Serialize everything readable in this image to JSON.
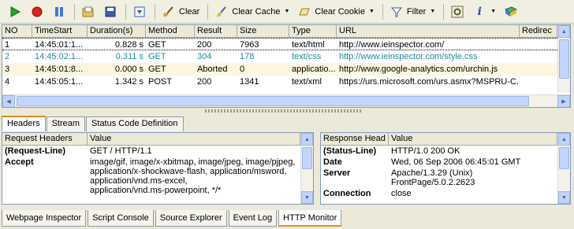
{
  "toolbar": {
    "clear_label": "Clear",
    "clear_cache_label": "Clear Cache",
    "clear_cookie_label": "Clear Cookie",
    "filter_label": "Filter"
  },
  "grid": {
    "columns": [
      "NO",
      "TimeStart",
      "Duration(s)",
      "Method",
      "Result",
      "Size",
      "Type",
      "URL",
      "Redirec"
    ],
    "rows": [
      {
        "no": "1",
        "time": "14:45:01:1...",
        "dur": "0.828 s",
        "method": "GET",
        "result": "200",
        "size": "7963",
        "type": "text/html",
        "url": "http://www.ieinspector.com/",
        "redirect": ""
      },
      {
        "no": "2",
        "time": "14:45:02:1...",
        "dur": "0.311 s",
        "method": "GET",
        "result": "304",
        "size": "178",
        "type": "text/css",
        "url": "http://www.ieinspector.com/style.css",
        "redirect": ""
      },
      {
        "no": "3",
        "time": "14:45:01:8...",
        "dur": "0.000 s",
        "method": "GET",
        "result": "Aborted",
        "size": "0",
        "type": "applicatio...",
        "url": "http://www.google-analytics.com/urchin.js",
        "redirect": ""
      },
      {
        "no": "4",
        "time": "14:45:05:1...",
        "dur": "1.342 s",
        "method": "POST",
        "result": "200",
        "size": "1341",
        "type": "text/xml",
        "url": "https://urs.microsoft.com/urs.asmx?MSPRU-C...",
        "redirect": ""
      }
    ]
  },
  "tabs": [
    "Headers",
    "Stream",
    "Status Code Definition"
  ],
  "request_panel": {
    "col_key": "Request Headers",
    "col_value": "Value",
    "rows": [
      {
        "key": "(Request-Line)",
        "value": "GET / HTTP/1.1"
      },
      {
        "key": "Accept",
        "value": "image/gif, image/x-xbitmap, image/jpeg, image/pjpeg,\napplication/x-shockwave-flash, application/msword,\napplication/vnd.ms-excel,\napplication/vnd.ms-powerpoint, */*"
      }
    ]
  },
  "response_panel": {
    "col_key": "Response Head",
    "col_value": "Value",
    "rows": [
      {
        "key": "(Status-Line)",
        "value": "HTTP/1.0 200 OK"
      },
      {
        "key": "Date",
        "value": "Wed, 06 Sep 2006 06:45:01 GMT"
      },
      {
        "key": "Server",
        "value": "Apache/1.3.29 (Unix)\nFrontPage/5.0.2.2623"
      },
      {
        "key": "Connection",
        "value": "close"
      }
    ]
  },
  "bottom_tabs": [
    "Webpage Inspector",
    "Script Console",
    "Source Explorer",
    "Event Log",
    "HTTP Monitor"
  ]
}
